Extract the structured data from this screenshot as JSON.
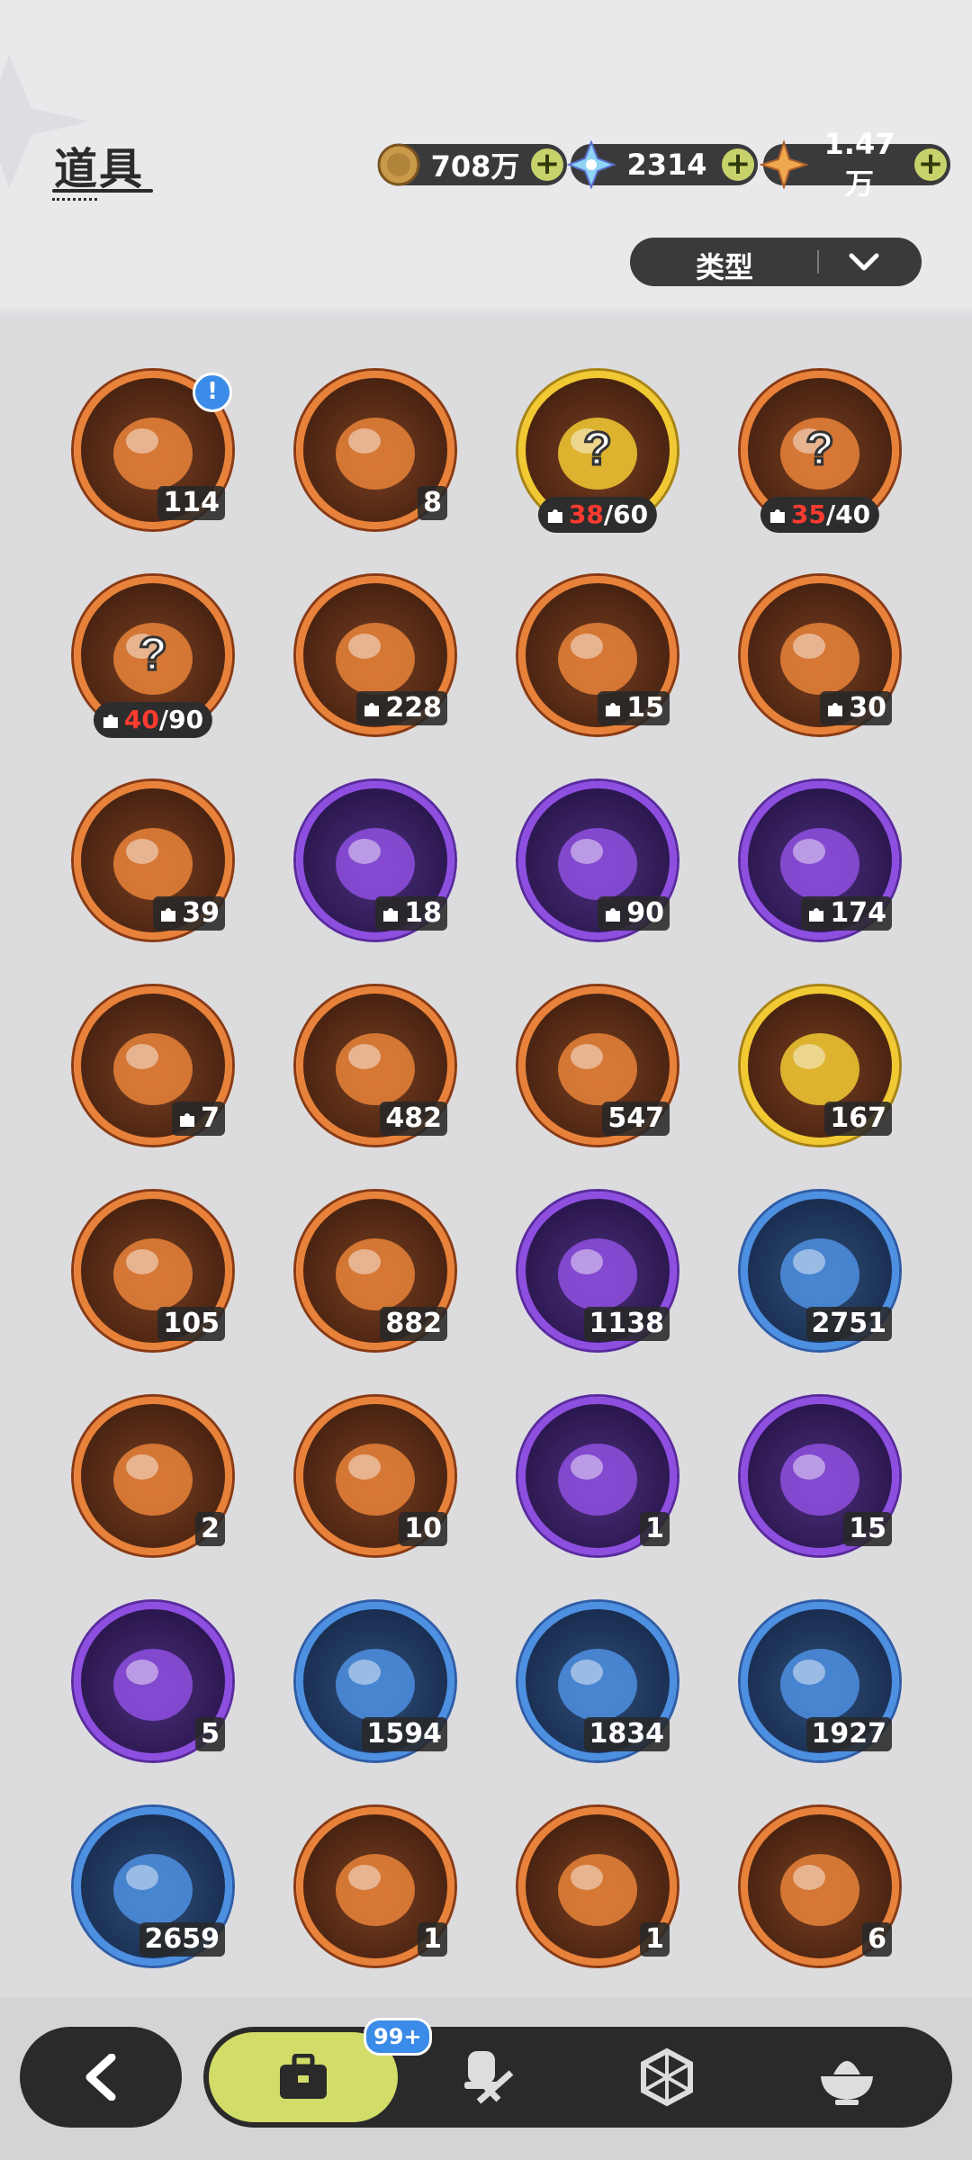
{
  "header": {
    "title": "道具",
    "currencies": [
      {
        "icon": "gold-coin-icon",
        "value": "708万"
      },
      {
        "icon": "crystal-icon",
        "value": "2314"
      },
      {
        "icon": "star-shard-icon",
        "value": "1.47万"
      }
    ],
    "plus_label": "+",
    "filter_label": "类型"
  },
  "colors": {
    "orange": "#e8823a",
    "purple": "#8e4fe0",
    "blue": "#4d8fe0",
    "gold": "#f1c933",
    "accent": "#d2dc68"
  },
  "items": [
    {
      "icon": "treasure-chest-icon",
      "rarity": "orange",
      "count": "114",
      "alert": "!"
    },
    {
      "icon": "purple-crystal-icon",
      "rarity": "orange",
      "count": "8"
    },
    {
      "icon": "mystery-fragment-icon",
      "rarity": "gold",
      "fragment": true,
      "have": "38",
      "need": "/60"
    },
    {
      "icon": "mystery-fragment-icon",
      "rarity": "orange",
      "fragment": true,
      "have": "35",
      "need": "/40"
    },
    {
      "icon": "mystery-fragment-icon",
      "rarity": "orange",
      "fragment": true,
      "have": "40",
      "need": "/90"
    },
    {
      "icon": "knight-pet-fragment-icon",
      "rarity": "orange",
      "fragment": true,
      "count": "228"
    },
    {
      "icon": "white-pet-fragment-icon",
      "rarity": "orange",
      "fragment": true,
      "count": "15"
    },
    {
      "icon": "brown-pet-fragment-icon",
      "rarity": "orange",
      "fragment": true,
      "count": "30"
    },
    {
      "icon": "lilac-pet-fragment-icon",
      "rarity": "orange",
      "fragment": true,
      "count": "39"
    },
    {
      "icon": "green-bear-fragment-icon",
      "rarity": "purple",
      "fragment": true,
      "count": "18"
    },
    {
      "icon": "panda-fragment-icon",
      "rarity": "purple",
      "fragment": true,
      "count": "90"
    },
    {
      "icon": "yellow-bear-fragment-icon",
      "rarity": "purple",
      "fragment": true,
      "count": "174"
    },
    {
      "icon": "tiger-fragment-icon",
      "rarity": "orange",
      "fragment": true,
      "count": "7"
    },
    {
      "icon": "pink-star-crystal-icon",
      "rarity": "orange",
      "count": "482"
    },
    {
      "icon": "blue-star-crystal-icon",
      "rarity": "orange",
      "count": "547"
    },
    {
      "icon": "gold-card-icon",
      "rarity": "gold",
      "count": "167"
    },
    {
      "icon": "rainbow-card-icon",
      "rarity": "orange",
      "count": "105"
    },
    {
      "icon": "orange-card-icon",
      "rarity": "orange",
      "count": "882"
    },
    {
      "icon": "purple-card-icon",
      "rarity": "purple",
      "count": "1138"
    },
    {
      "icon": "blue-card-icon",
      "rarity": "blue",
      "count": "2751"
    },
    {
      "icon": "refresh-card-icon",
      "rarity": "orange",
      "count": "2"
    },
    {
      "icon": "clover-card-icon",
      "rarity": "orange",
      "count": "10"
    },
    {
      "icon": "gift-box-icon",
      "rarity": "purple",
      "count": "1"
    },
    {
      "icon": "golden-bell-icon",
      "rarity": "purple",
      "count": "15"
    },
    {
      "icon": "scroll-icon",
      "rarity": "purple",
      "count": "5"
    },
    {
      "icon": "shovel-icon",
      "rarity": "blue",
      "count": "1594"
    },
    {
      "icon": "boxing-glove-icon",
      "rarity": "blue",
      "count": "1834"
    },
    {
      "icon": "pickaxe-icon",
      "rarity": "blue",
      "count": "1927"
    },
    {
      "icon": "hammer-icon",
      "rarity": "blue",
      "count": "2659"
    },
    {
      "icon": "green-cloud-icon",
      "rarity": "orange",
      "count": "1"
    },
    {
      "icon": "potion-icon",
      "rarity": "orange",
      "count": "1"
    },
    {
      "icon": "golden-key-icon",
      "rarity": "orange",
      "count": "6"
    }
  ],
  "nav": {
    "back_icon": "back-arrow-icon",
    "badge": "99+",
    "tabs": [
      "bag-icon",
      "chef-hat-icon",
      "hexagon-icon",
      "dessert-icon"
    ]
  }
}
